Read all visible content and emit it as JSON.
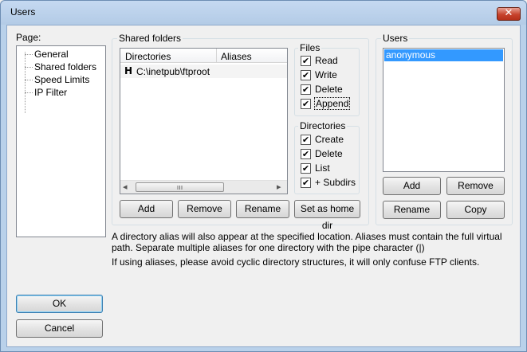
{
  "window": {
    "title": "Users",
    "close_glyph": "✕"
  },
  "page_panel": {
    "label": "Page:",
    "items": [
      {
        "label": "General"
      },
      {
        "label": "Shared folders"
      },
      {
        "label": "Speed Limits"
      },
      {
        "label": "IP Filter"
      }
    ]
  },
  "shared_folders": {
    "title": "Shared folders",
    "columns": [
      "Directories",
      "Aliases"
    ],
    "rows": [
      {
        "flag": "H",
        "directory": "C:\\inetpub\\ftproot",
        "alias": ""
      }
    ],
    "scrollbar": {
      "left_glyph": "◂",
      "right_glyph": "▸",
      "thumb_glyph": "ııı"
    },
    "buttons": {
      "add": "Add",
      "remove": "Remove",
      "rename": "Rename",
      "set_home": "Set as home dir"
    }
  },
  "files_group": {
    "title": "Files",
    "items": [
      {
        "label": "Read",
        "checked": true
      },
      {
        "label": "Write",
        "checked": true
      },
      {
        "label": "Delete",
        "checked": true
      },
      {
        "label": "Append",
        "checked": true
      }
    ]
  },
  "directories_group": {
    "title": "Directories",
    "items": [
      {
        "label": "Create",
        "checked": true
      },
      {
        "label": "Delete",
        "checked": true
      },
      {
        "label": "List",
        "checked": true
      },
      {
        "label": "+ Subdirs",
        "checked": true
      }
    ]
  },
  "check_glyph": "✔",
  "users": {
    "title": "Users",
    "items": [
      {
        "label": "anonymous",
        "selected": true
      }
    ],
    "buttons": {
      "add": "Add",
      "remove": "Remove",
      "rename": "Rename",
      "copy": "Copy"
    }
  },
  "info": {
    "line1": "A directory alias will also appear at the specified location. Aliases must contain the full virtual",
    "line2": "path. Separate multiple aliases for one directory with the pipe character (|)",
    "line3": "If using aliases, please avoid cyclic directory structures, it will only confuse FTP clients."
  },
  "dialog_buttons": {
    "ok": "OK",
    "cancel": "Cancel"
  },
  "colors": {
    "selection": "#3399ff",
    "accent": "#3c7fb1"
  }
}
